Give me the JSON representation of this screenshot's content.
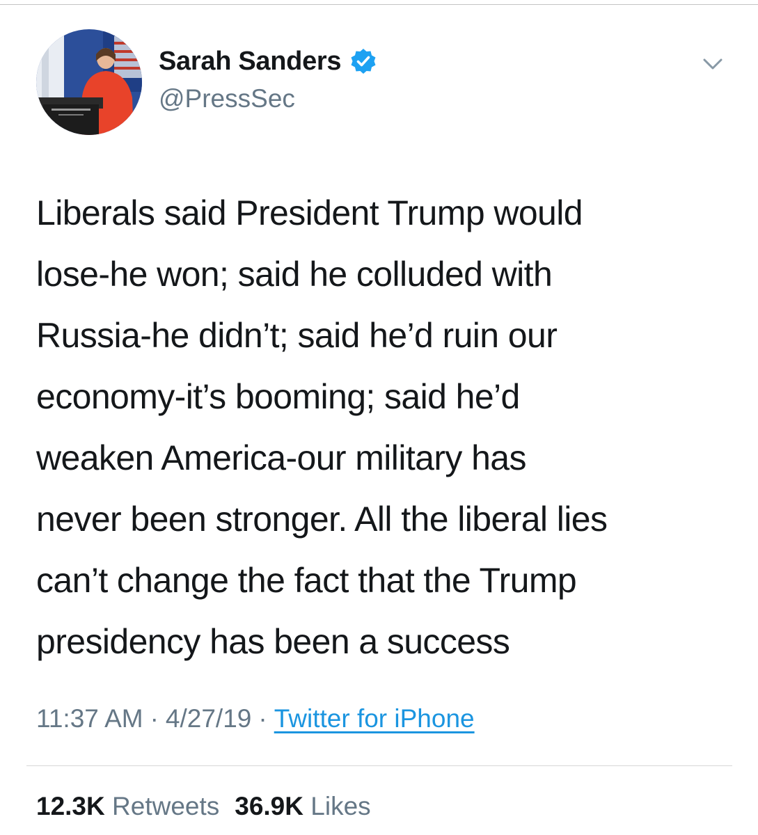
{
  "author": {
    "display_name": "Sarah Sanders",
    "handle": "@PressSec",
    "verified": true,
    "avatar_icon": "profile-photo-podium"
  },
  "menu": {
    "icon": "chevron-down-icon"
  },
  "tweet": {
    "lines": [
      "Liberals said President Trump would",
      "lose-he won; said he colluded with",
      "Russia-he didn’t; said he’d ruin our",
      "economy-it’s booming; said he’d",
      "weaken America-our military has",
      "never been stronger. All the liberal lies",
      "can’t change the fact that the Trump",
      "presidency has been a success"
    ]
  },
  "meta": {
    "time": "11:37 AM",
    "separator": "·",
    "date": "4/27/19",
    "source": "Twitter for iPhone"
  },
  "stats": {
    "retweets_count": "12.3K",
    "retweets_label": "Retweets",
    "likes_count": "36.9K",
    "likes_label": "Likes"
  },
  "colors": {
    "text": "#14171a",
    "secondary": "#657786",
    "link": "#1b95e0",
    "verified_badge": "#1da1f2"
  }
}
